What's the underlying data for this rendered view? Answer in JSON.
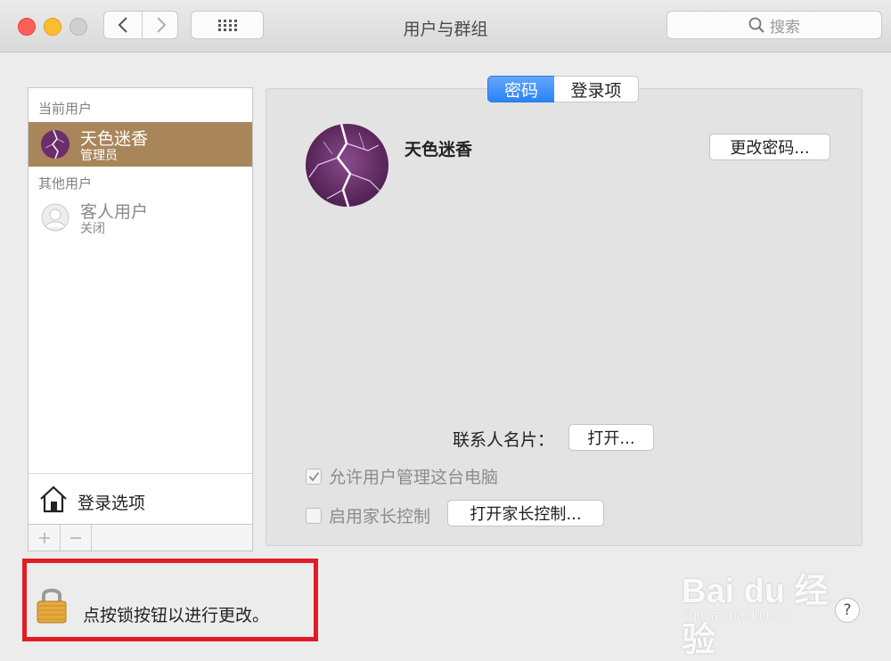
{
  "window": {
    "title": "用户与群组"
  },
  "toolbar": {
    "search_placeholder": "搜索"
  },
  "sidebar": {
    "current_users_label": "当前用户",
    "current_user": {
      "name": "天色迷香",
      "role": "管理员"
    },
    "other_users_label": "其他用户",
    "guest_user": {
      "name": "客人用户",
      "status": "关闭"
    },
    "login_options_label": "登录选项",
    "add_symbol": "+",
    "remove_symbol": "−"
  },
  "tabs": [
    {
      "label": "密码",
      "selected": true
    },
    {
      "label": "登录项",
      "selected": false
    }
  ],
  "detail": {
    "user_name": "天色迷香",
    "change_password_label": "更改密码...",
    "contact_card_label": "联系人名片：",
    "open_label": "打开...",
    "allow_admin_label": "允许用户管理这台电脑",
    "allow_admin_checked": true,
    "parental_controls_label": "启用家长控制",
    "parental_controls_checked": false,
    "open_parental_label": "打开家长控制..."
  },
  "lock": {
    "message": "点按锁按钮以进行更改。"
  },
  "watermark": {
    "brand": "Bai du 经验",
    "url": "jingyan.baidu.com"
  },
  "help": {
    "label": "?"
  },
  "colors": {
    "selection": "#a9865a",
    "accent_blue": "#2b83f6",
    "highlight_border": "#e11c24",
    "avatar_purple": "#6b2d6b"
  }
}
